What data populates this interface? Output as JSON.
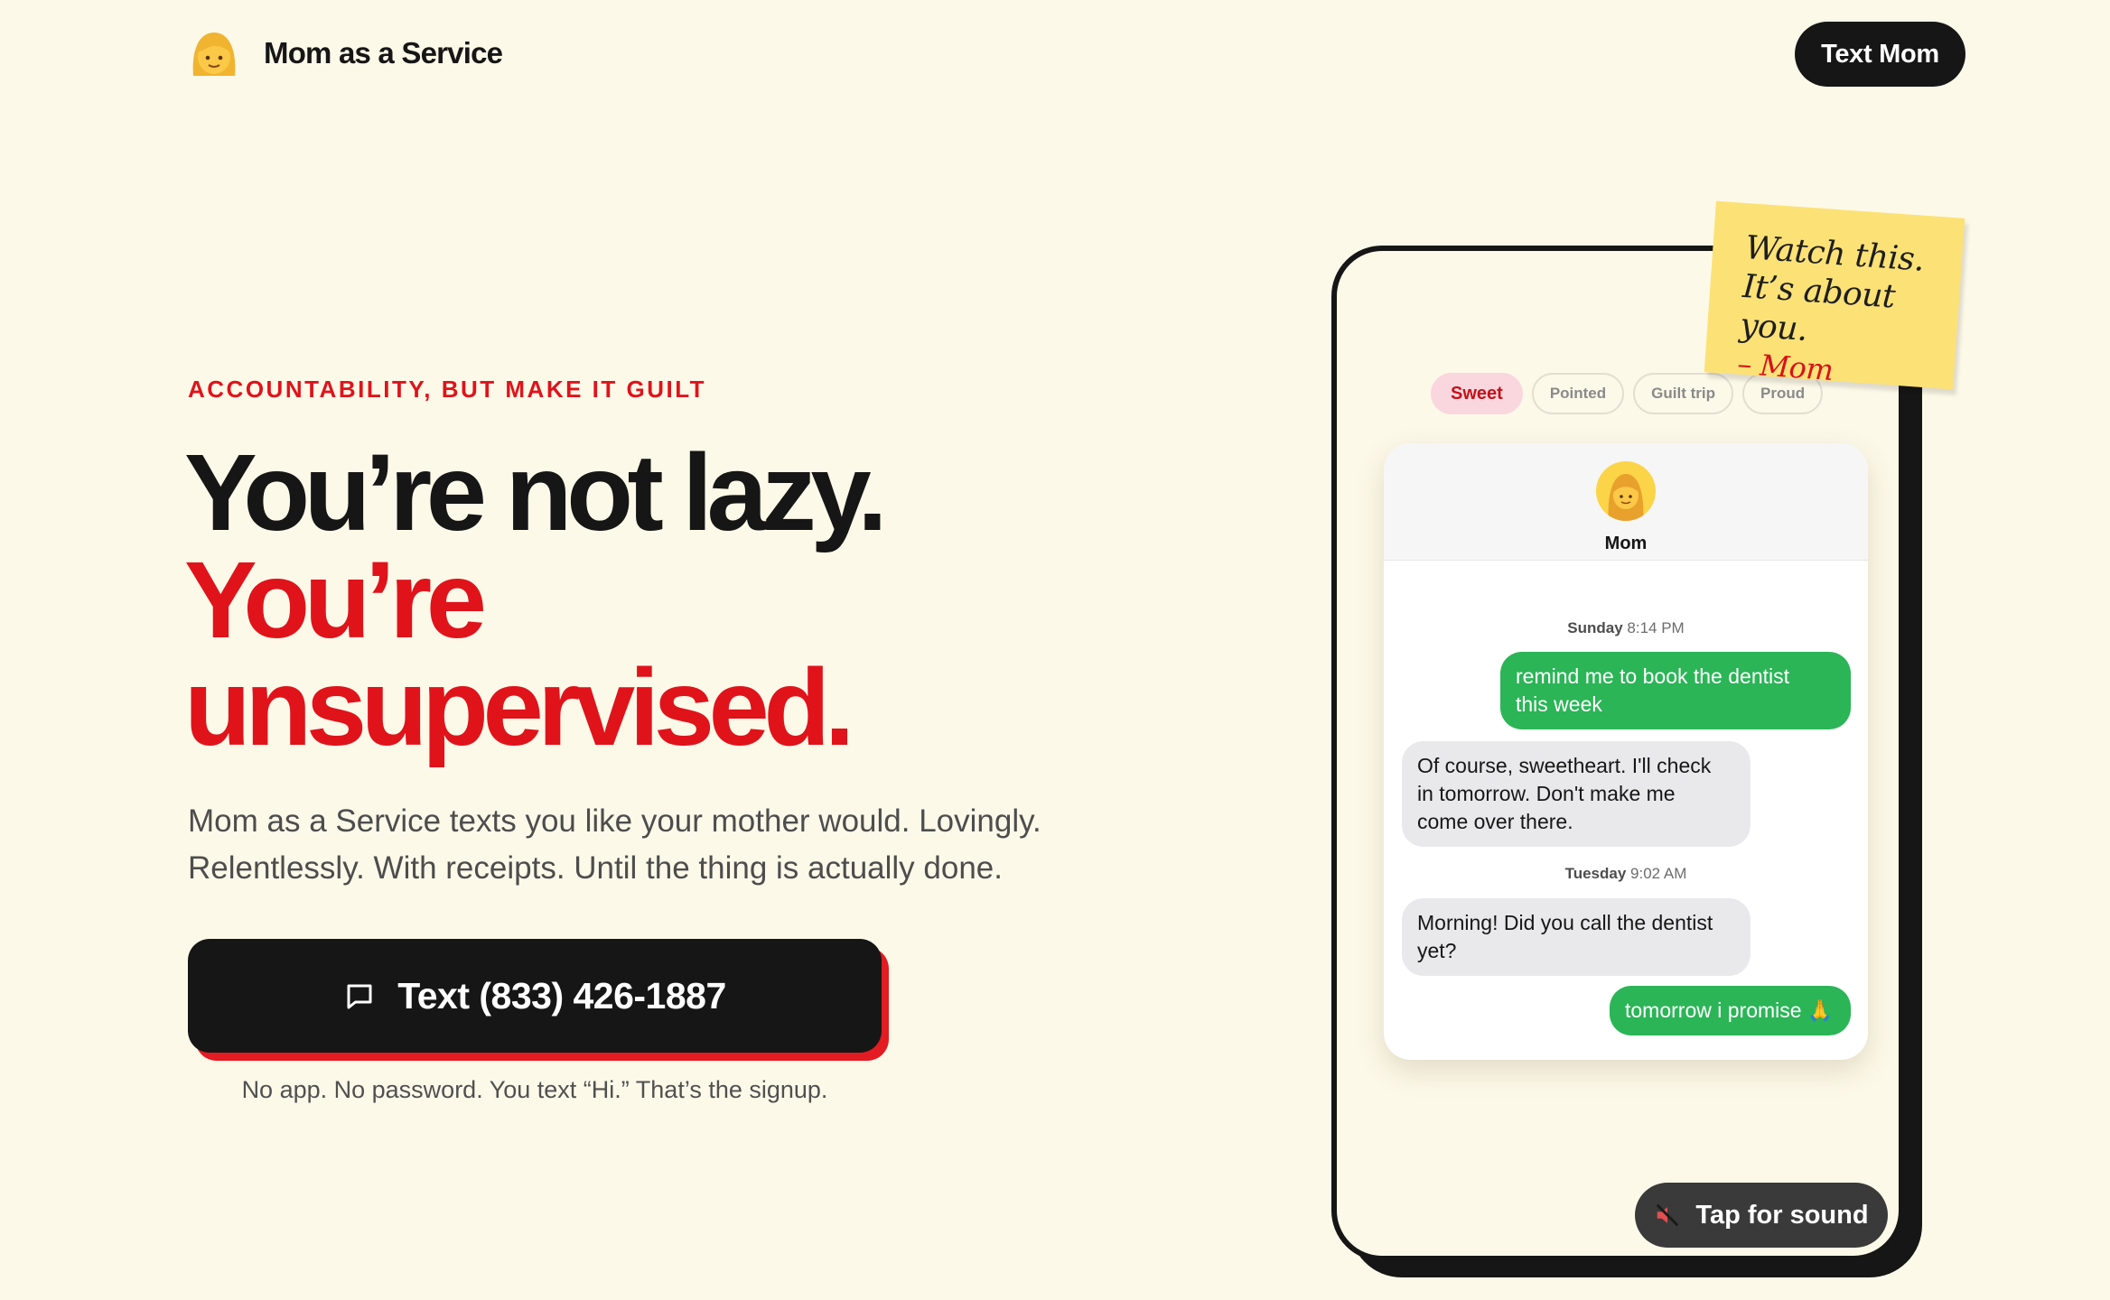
{
  "nav": {
    "brand": "Mom as a Service",
    "cta_label": "Text Mom",
    "logo_icon": "woman-emoji-icon"
  },
  "hero": {
    "eyebrow": "ACCOUNTABILITY, BUT MAKE IT GUILT",
    "headline_line1": "You’re not lazy.",
    "headline_line2": "You’re",
    "headline_line3": "unsupervised.",
    "lede_line1": "Mom as a Service texts you like your mother would. Lovingly.",
    "lede_line2": "Relentlessly. With receipts. Until the thing is actually done.",
    "cta_label": "Text (833) 426-1887",
    "cta_icon": "chat-bubble-icon",
    "cta_note": "No app. No password. You text “Hi.” That’s the signup."
  },
  "phone": {
    "tabs": [
      "Sweet",
      "Pointed",
      "Guilt trip",
      "Proud"
    ],
    "active_tab": "Sweet",
    "contact_name": "Mom",
    "stamp1_day": "Sunday",
    "stamp1_time": "8:14 PM",
    "stamp2_day": "Tuesday",
    "stamp2_time": "9:02 AM",
    "messages": [
      {
        "from": "user",
        "text_line1": "remind me to book the dentist",
        "text_line2": "this week"
      },
      {
        "from": "mom",
        "text_line1": "Of course, sweetheart. I'll check",
        "text_line2": "in tomorrow. Don't make me",
        "text_line3": "come over there."
      },
      {
        "from": "mom",
        "text_line1": "Morning! Did you call the dentist",
        "text_line2": "yet?"
      },
      {
        "from": "user",
        "text_line1": "tomorrow i promise 🙏"
      }
    ],
    "sound_label": "Tap for sound",
    "sound_icon": "muted-speaker-icon"
  },
  "sticky_note": {
    "line1": "Watch this.",
    "line2": "It’s about you.",
    "line3": "– Mom"
  },
  "colors": {
    "background": "#fdf9e9",
    "accent_red": "#e0131b",
    "ink": "#161616",
    "imessage_green": "#2bb557",
    "sticky_yellow": "#fce276"
  }
}
